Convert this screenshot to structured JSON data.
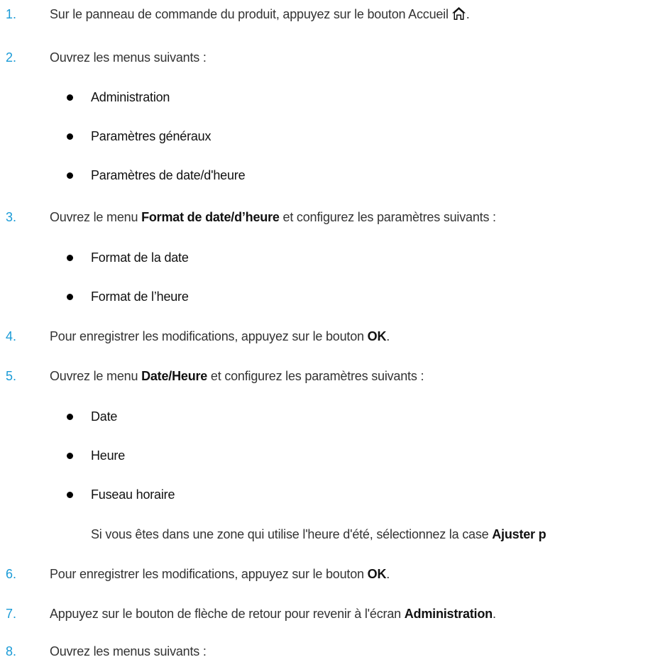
{
  "steps": [
    {
      "num": "1.",
      "pre": "Sur le panneau de commande du produit, appuyez sur le bouton Accueil",
      "bold": "",
      "post": "."
    },
    {
      "num": "2.",
      "pre": "Ouvrez les menus suivants :",
      "bold": "",
      "post": ""
    },
    {
      "num": "3.",
      "pre": "Ouvrez le menu ",
      "bold": "Format de date/d’heure",
      "post": " et configurez les paramètres suivants :"
    },
    {
      "num": "4.",
      "pre": "Pour enregistrer les modifications, appuyez sur le bouton ",
      "bold": "OK",
      "post": "."
    },
    {
      "num": "5.",
      "pre": "Ouvrez le menu ",
      "bold": "Date/Heure",
      "post": " et configurez les paramètres suivants :"
    },
    {
      "num": "6.",
      "pre": "Pour enregistrer les modifications, appuyez sur le bouton ",
      "bold": "OK",
      "post": "."
    },
    {
      "num": "7.",
      "pre": "Appuyez sur le bouton de flèche de retour pour revenir à l'écran ",
      "bold": "Administration",
      "post": "."
    },
    {
      "num": "8.",
      "pre": "Ouvrez les menus suivants :",
      "bold": "",
      "post": ""
    }
  ],
  "bullets_step2": [
    "Administration",
    "Paramètres généraux",
    "Paramètres de date/d'heure"
  ],
  "bullets_step3": [
    "Format de la date",
    "Format de l’heure"
  ],
  "bullets_step5": [
    "Date",
    "Heure",
    "Fuseau horaire"
  ],
  "note_step5": {
    "pre": "Si vous êtes dans une zone qui utilise l'heure d'été, sélectionnez la case ",
    "bold": "Ajuster p"
  },
  "icons": {
    "home": "home-icon"
  },
  "colors": {
    "step_number": "#1a9bd7",
    "text": "#333333"
  }
}
